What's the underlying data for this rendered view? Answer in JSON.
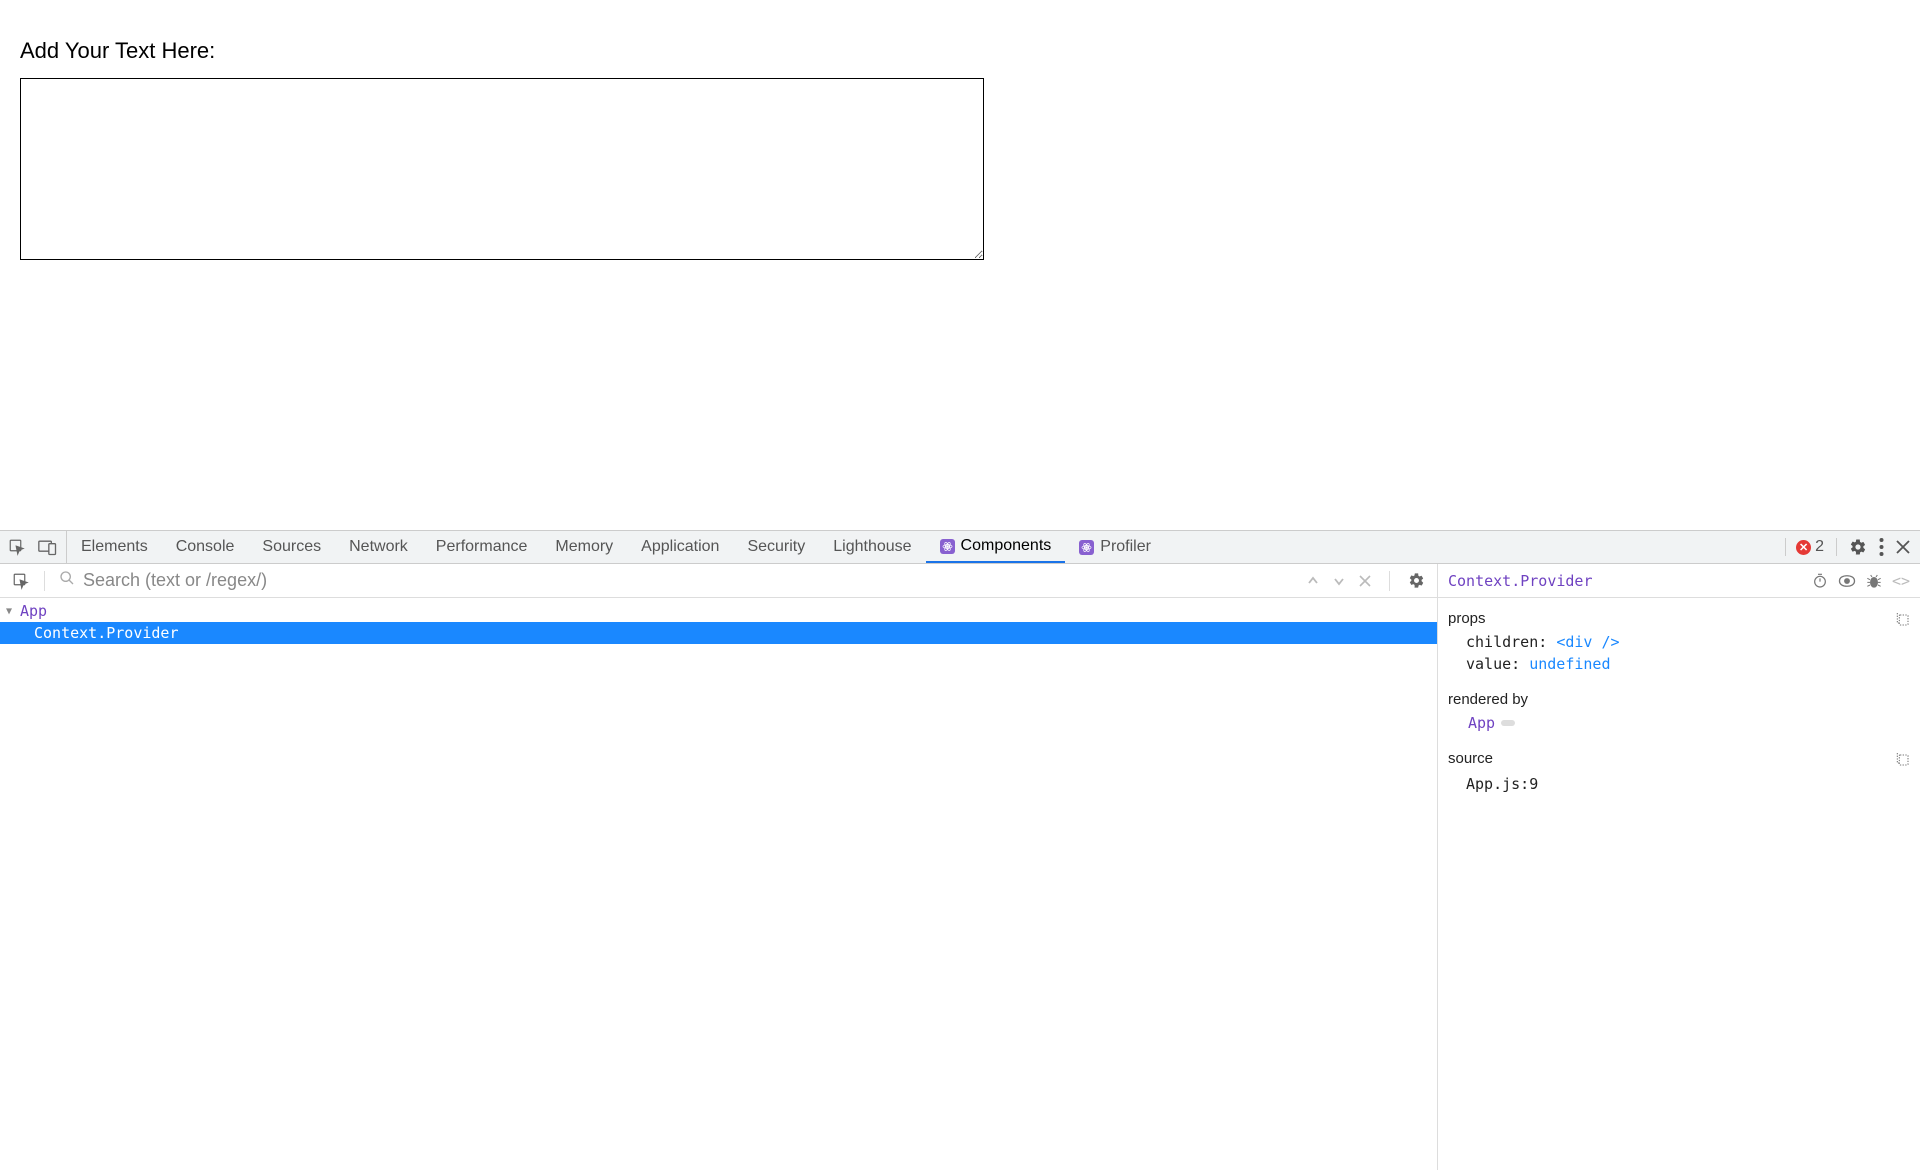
{
  "page": {
    "label": "Add Your Text Here:",
    "textarea_value": ""
  },
  "devtools": {
    "tabs": {
      "elements": "Elements",
      "console": "Console",
      "sources": "Sources",
      "network": "Network",
      "performance": "Performance",
      "memory": "Memory",
      "application": "Application",
      "security": "Security",
      "lighthouse": "Lighthouse",
      "components": "Components",
      "profiler": "Profiler"
    },
    "active_tab": "components",
    "errors_count": "2"
  },
  "tree": {
    "search_placeholder": "Search (text or /regex/)",
    "root": "App",
    "selected": "Context.Provider"
  },
  "details": {
    "title": "Context.Provider",
    "sections": {
      "props": "props",
      "rendered_by": "rendered by",
      "source": "source"
    },
    "props": {
      "children_key": "children",
      "children_val": "<div />",
      "value_key": "value",
      "value_val": "undefined"
    },
    "rendered_by_value": "App",
    "source_value": "App.js:9"
  }
}
